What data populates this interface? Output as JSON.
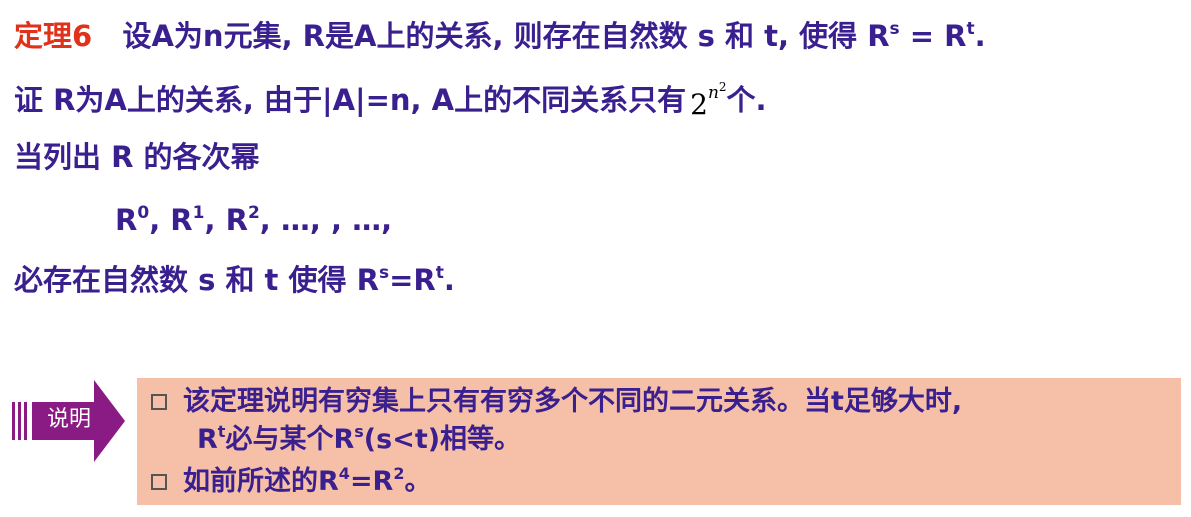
{
  "theorem": {
    "label": "定理6",
    "statement": "设A为n元集, R是A上的关系, 则存在自然数 s 和 t,  使得 R",
    "sup_s": "s",
    "eq": " = R",
    "sup_t": "t",
    "end": "."
  },
  "proof": {
    "line1": "证  R为A上的关系,  由于|A|=n,  A上的不同关系只有",
    "math_base": "2",
    "math_exp_var": "n",
    "math_exp_pow": "2",
    "line1_end": "个.",
    "line2": "当列出 R 的各次幂",
    "powers": {
      "r0": "R",
      "s0": "0",
      "r1": ", R",
      "s1": "1",
      "r2": ", R",
      "s2": "2",
      "rest": ", …, , …,"
    },
    "line4_prefix": "必存在自然数 s 和 t 使得  R",
    "line4_sup_s": "s",
    "line4_eq": "=R",
    "line4_sup_t": "t",
    "line4_end": "."
  },
  "note": {
    "tag": "说明",
    "item1_text": "该定理说明有穷集上只有有穷多个不同的二元关系。当t足够大时,",
    "item1_cont_r": "R",
    "item1_cont_sup_t": "t",
    "item1_cont_mid": "必与某个R",
    "item1_cont_sup_s": "s",
    "item1_cont_end": "(s<t)相等。",
    "item2_r": "如前所述的R",
    "item2_sup_4": "4",
    "item2_eq": "=R",
    "item2_sup_2": "2",
    "item2_end": "。"
  },
  "colors": {
    "text": "#3a1f8f",
    "accent": "#e0311b",
    "note_bg": "#f6c0a8",
    "tag_bg": "#8a1b84"
  }
}
